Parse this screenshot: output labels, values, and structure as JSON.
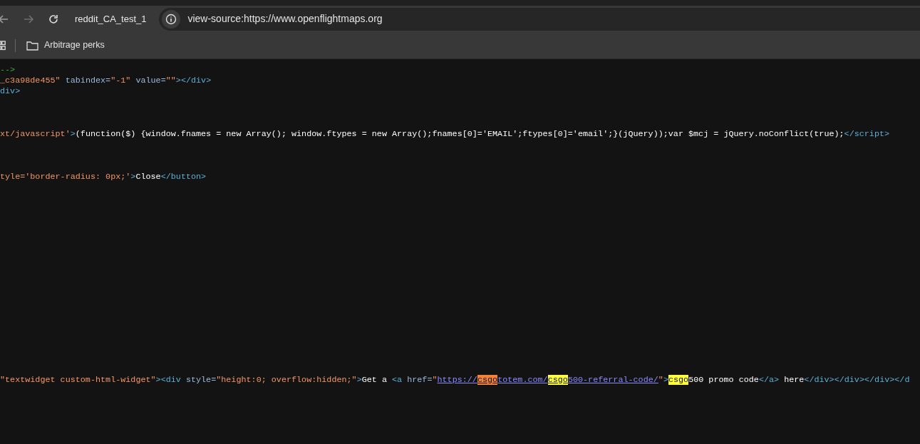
{
  "toolbar": {
    "back": {
      "disabled": false
    },
    "forward": {
      "disabled": true
    },
    "profile_label": "reddit_CA_test_1",
    "address": "view-source:https://www.openflightmaps.org"
  },
  "bookmarks_bar": {
    "items": [
      {
        "label": "Arbitrage perks"
      }
    ]
  },
  "source_lines": [
    {
      "kind": "code",
      "tokens": [
        {
          "kind": "comment",
          "text": "-->"
        }
      ]
    },
    {
      "kind": "code",
      "tokens": [
        {
          "kind": "value",
          "text": "_c3a98de455\""
        },
        {
          "kind": "attr",
          "text": " tabindex="
        },
        {
          "kind": "value",
          "text": "\"-1\""
        },
        {
          "kind": "attr",
          "text": " value="
        },
        {
          "kind": "value",
          "text": "\"\""
        },
        {
          "kind": "tag",
          "text": "></div>"
        }
      ]
    },
    {
      "kind": "code",
      "tokens": [
        {
          "kind": "tag",
          "text": "div>"
        }
      ]
    },
    {
      "kind": "blank"
    },
    {
      "kind": "blank"
    },
    {
      "kind": "blank"
    },
    {
      "kind": "code",
      "tokens": [
        {
          "kind": "value",
          "text": "xt/javascript'"
        },
        {
          "kind": "tag",
          "text": ">"
        },
        {
          "kind": "text",
          "text": "(function($) {window.fnames = new Array(); window.ftypes = new Array();fnames[0]='EMAIL';ftypes[0]='email';}(jQuery));var $mcj = jQuery.noConflict(true);"
        },
        {
          "kind": "tag",
          "text": "</script>"
        }
      ]
    },
    {
      "kind": "blank"
    },
    {
      "kind": "blank"
    },
    {
      "kind": "blank"
    },
    {
      "kind": "code",
      "tokens": [
        {
          "kind": "value",
          "text": "tyle='border-radius: 0px;'"
        },
        {
          "kind": "tag",
          "text": ">"
        },
        {
          "kind": "text",
          "text": "Close"
        },
        {
          "kind": "tag",
          "text": "</button>"
        }
      ]
    },
    {
      "kind": "blank"
    },
    {
      "kind": "blank"
    },
    {
      "kind": "blank"
    },
    {
      "kind": "blank"
    },
    {
      "kind": "blank"
    },
    {
      "kind": "blank"
    },
    {
      "kind": "blank"
    },
    {
      "kind": "blank"
    },
    {
      "kind": "blank"
    },
    {
      "kind": "blank"
    },
    {
      "kind": "blank"
    },
    {
      "kind": "blank"
    },
    {
      "kind": "blank"
    },
    {
      "kind": "blank"
    },
    {
      "kind": "blank"
    },
    {
      "kind": "blank"
    },
    {
      "kind": "blank"
    },
    {
      "kind": "blank"
    },
    {
      "kind": "code",
      "tokens": [
        {
          "kind": "value",
          "text": "\"textwidget custom-html-widget\""
        },
        {
          "kind": "tag",
          "text": "><div"
        },
        {
          "kind": "attr",
          "text": " style="
        },
        {
          "kind": "value",
          "text": "\"height:0; overflow:hidden;\""
        },
        {
          "kind": "tag",
          "text": ">"
        },
        {
          "kind": "text",
          "text": "Get a "
        },
        {
          "kind": "tag",
          "text": "<a"
        },
        {
          "kind": "attr",
          "text": " href="
        },
        {
          "kind": "value",
          "text": "\""
        },
        {
          "kind": "link",
          "text": "https://"
        },
        {
          "kind": "link",
          "text": "csgo",
          "current_match": true
        },
        {
          "kind": "link",
          "text": "totem.com/"
        },
        {
          "kind": "link",
          "text": "csgo",
          "current_match": false
        },
        {
          "kind": "link",
          "text": "500-referral-code/"
        },
        {
          "kind": "value",
          "text": "\""
        },
        {
          "kind": "tag",
          "text": ">"
        },
        {
          "kind": "text",
          "text": "csgo",
          "current_match": false
        },
        {
          "kind": "text",
          "text": "500 promo code"
        },
        {
          "kind": "tag",
          "text": "</a>"
        },
        {
          "kind": "text",
          "text": " here"
        },
        {
          "kind": "tag",
          "text": "</div></div></div></d"
        }
      ]
    }
  ]
}
